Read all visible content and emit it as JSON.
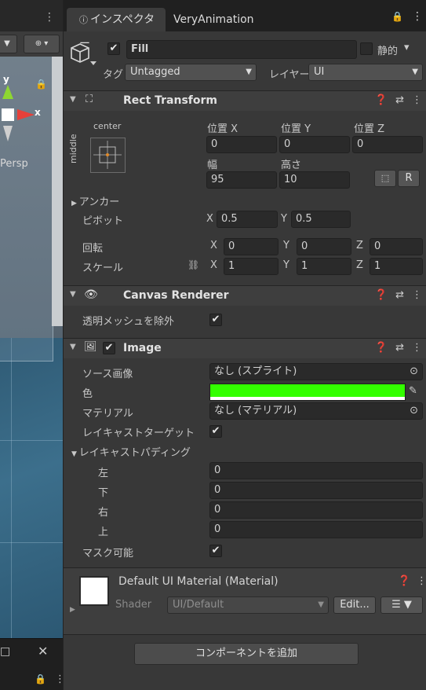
{
  "scene": {
    "persp_label": "Persp",
    "axis_y": "y",
    "axis_x": "x"
  },
  "tabs": {
    "inspector": "インスペクター",
    "veryanimation": "VeryAnimation"
  },
  "object": {
    "active": true,
    "name": "Fill",
    "static_label": "静的",
    "tag_label": "タグ",
    "tag_value": "Untagged",
    "layer_label": "レイヤー",
    "layer_value": "UI"
  },
  "rect_transform": {
    "title": "Rect Transform",
    "anchor_h": "center",
    "anchor_v": "middle",
    "pos_x_label": "位置 X",
    "pos_y_label": "位置 Y",
    "pos_z_label": "位置 Z",
    "pos_x": "0",
    "pos_y": "0",
    "pos_z": "0",
    "width_label": "幅",
    "height_label": "高さ",
    "width": "95",
    "height": "10",
    "r_button": "R",
    "anchors_label": "アンカー",
    "pivot_label": "ピボット",
    "pivot_x_label": "X",
    "pivot_x": "0.5",
    "pivot_y_label": "Y",
    "pivot_y": "0.5",
    "rotation_label": "回転",
    "rot_x": "0",
    "rot_y": "0",
    "rot_z": "0",
    "scale_label": "スケール",
    "scale_x": "1",
    "scale_y": "1",
    "scale_z": "1",
    "axis_x": "X",
    "axis_y": "Y",
    "axis_z": "Z"
  },
  "canvas_renderer": {
    "title": "Canvas Renderer",
    "cull_label": "透明メッシュを除外",
    "cull": true
  },
  "image": {
    "title": "Image",
    "enabled": true,
    "source_label": "ソース画像",
    "source_value": "なし (スプライト)",
    "color_label": "色",
    "color": "#33ff00",
    "material_label": "マテリアル",
    "material_value": "なし (マテリアル)",
    "raycast_label": "レイキャストターゲット",
    "raycast": true,
    "padding_label": "レイキャストパディング",
    "left_label": "左",
    "left": "0",
    "bottom_label": "下",
    "bottom": "0",
    "right_label": "右",
    "right": "0",
    "top_label": "上",
    "top": "0",
    "maskable_label": "マスク可能",
    "maskable": true
  },
  "material": {
    "title": "Default UI Material (Material)",
    "shader_label": "Shader",
    "shader_value": "UI/Default",
    "edit_button": "Edit..."
  },
  "add_component": "コンポーネントを追加"
}
